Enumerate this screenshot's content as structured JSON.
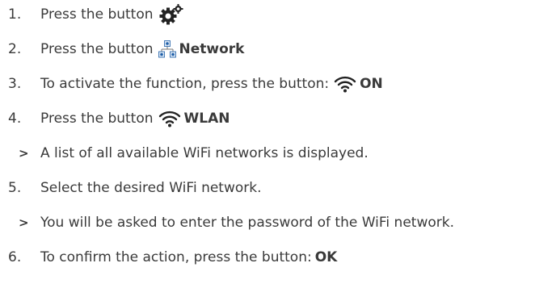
{
  "steps": [
    {
      "num": "1.",
      "text": "Press the button",
      "icon": "gear-icon"
    },
    {
      "num": "2.",
      "text": "Press the button",
      "icon": "network-icon",
      "bold": "Network"
    },
    {
      "num": "3.",
      "text": "To activate the function, press the button:",
      "icon": "wifi-icon",
      "bold": "ON"
    },
    {
      "num": "4.",
      "text": "Press the button",
      "icon": "wifi-icon",
      "bold": "WLAN"
    },
    {
      "marker": ">",
      "text": "A list of all available WiFi networks is displayed."
    },
    {
      "num": "5.",
      "text": "Select the desired WiFi network."
    },
    {
      "marker": ">",
      "text": "You will be asked to enter the password of the WiFi network."
    },
    {
      "num": "6.",
      "text": "To confirm the action, press the button:",
      "bold": "OK"
    }
  ],
  "colors": {
    "text": "#3a3a3a",
    "icon": "#222222",
    "network_blue": "#1f5fa8"
  }
}
